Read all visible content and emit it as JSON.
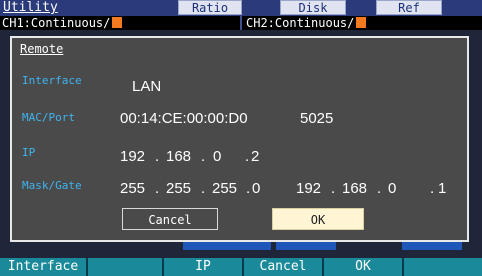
{
  "topbar": {
    "title": "Utility",
    "tabs": [
      "Ratio",
      "Disk",
      "Ref"
    ]
  },
  "channels": {
    "ch1": "CH1:Continuous/",
    "ch2": "CH2:Continuous/",
    "swatch_color": "#f47a20"
  },
  "dialog": {
    "title": "Remote",
    "rows": {
      "interface": {
        "label": "Interface",
        "value": "LAN"
      },
      "mac": {
        "label": "MAC/Port",
        "mac": "00:14:CE:00:00:D0",
        "port": "5025"
      },
      "ip": {
        "label": "IP",
        "o1": "192",
        "o2": "168",
        "o3": "0",
        "o4": "2"
      },
      "mask": {
        "label": "Mask/Gate",
        "m1": "255",
        "m2": "255",
        "m3": "255",
        "m4": "0",
        "g1": "192",
        "g2": "168",
        "g3": "0",
        "g4": "1"
      }
    },
    "cancel_label": "Cancel",
    "ok_label": "OK"
  },
  "softkeys": {
    "k1": "Interface",
    "k2": "",
    "k3": "IP",
    "k4": "Cancel",
    "k5": "OK",
    "k6": ""
  }
}
